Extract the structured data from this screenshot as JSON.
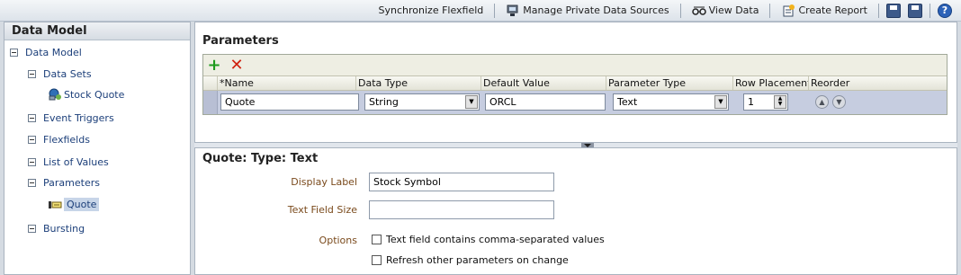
{
  "toolbar": {
    "synchronize": "Synchronize Flexfield",
    "manage": "Manage Private Data Sources",
    "view_data": "View Data",
    "create_report": "Create Report",
    "help": "?"
  },
  "sidebar": {
    "title": "Data Model",
    "tree": {
      "root": "Data Model",
      "data_sets": "Data Sets",
      "stock_quote": "Stock Quote",
      "event_triggers": "Event Triggers",
      "flexfields": "Flexfields",
      "list_of_values": "List of Values",
      "parameters": "Parameters",
      "quote": "Quote",
      "bursting": "Bursting"
    }
  },
  "parameters": {
    "title": "Parameters",
    "columns": [
      "*Name",
      "Data Type",
      "Default Value",
      "Parameter Type",
      "Row Placement",
      "Reorder"
    ],
    "row": {
      "name": "Quote",
      "data_type": "String",
      "default_value": "ORCL",
      "parameter_type": "Text",
      "row_placement": "1"
    }
  },
  "detail": {
    "title": "Quote: Type: Text",
    "display_label_label": "Display Label",
    "display_label_value": "Stock Symbol",
    "text_field_size_label": "Text Field Size",
    "text_field_size_value": "",
    "options_label": "Options",
    "option_comma": "Text field contains comma-separated values",
    "option_refresh": "Refresh other parameters on change"
  },
  "colors": {
    "tree_link": "#1c3f7a",
    "form_label": "#7a4a1c",
    "selected_row": "#c6cde0"
  }
}
